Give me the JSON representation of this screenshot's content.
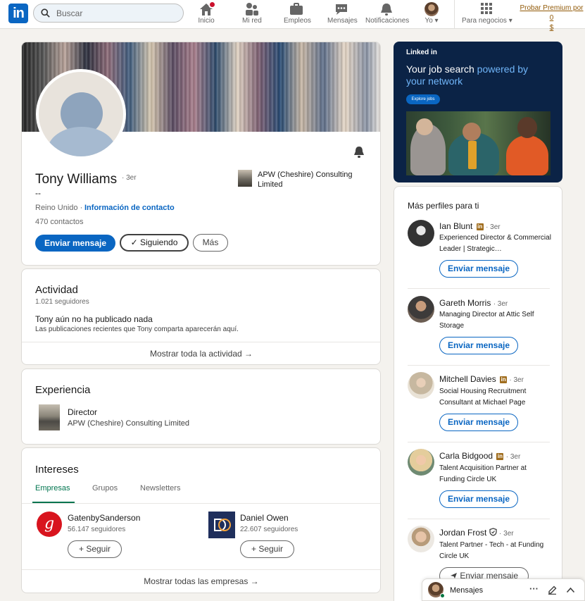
{
  "nav": {
    "search_placeholder": "Buscar",
    "items": [
      {
        "label": "Inicio",
        "icon": "home-icon"
      },
      {
        "label": "Mi red",
        "icon": "network-icon"
      },
      {
        "label": "Empleos",
        "icon": "briefcase-icon"
      },
      {
        "label": "Mensajes",
        "icon": "messaging-icon"
      },
      {
        "label": "Notificaciones",
        "icon": "bell-icon"
      },
      {
        "label": "Yo ▾",
        "icon": "avatar"
      },
      {
        "label": "Para negocios ▾",
        "icon": "grid-icon"
      }
    ],
    "premium_line1": "Probar Premium por 0",
    "premium_line2": "$",
    "accent": "#0a66c2"
  },
  "profile": {
    "name": "Tony Williams",
    "degree": "· 3er",
    "headline": "--",
    "location": "Reino Unido ·",
    "contact_link": "Información de contacto",
    "connections": "470 contactos",
    "company": "APW (Cheshire) Consulting Limited",
    "btn_message": "Enviar mensaje",
    "btn_following": "✓ Siguiendo",
    "btn_more": "Más"
  },
  "activity": {
    "title": "Actividad",
    "followers": "1.021 seguidores",
    "empty_title": "Tony aún no ha publicado nada",
    "empty_desc": "Las publicaciones recientes que Tony comparta aparecerán aquí.",
    "show_all": "Mostrar toda la actividad →"
  },
  "experience": {
    "title": "Experiencia",
    "role": "Director",
    "company": "APW (Cheshire) Consulting Limited"
  },
  "interests": {
    "title": "Intereses",
    "tabs": [
      "Empresas",
      "Grupos",
      "Newsletters"
    ],
    "companies": [
      {
        "name": "GatenbySanderson",
        "followers": "56.147 seguidores",
        "button": "+ Seguir"
      },
      {
        "name": "Daniel Owen",
        "followers": "22.607 seguidores",
        "button": "+ Seguir"
      }
    ],
    "show_all": "Mostrar todas las empresas →"
  },
  "ad": {
    "brand": "Linked in",
    "headline_a": "Your job search ",
    "headline_b": "powered by your network",
    "cta": "Explore jobs"
  },
  "more_profiles": {
    "title": "Más perfiles para ti",
    "people": [
      {
        "name": "Ian Blunt",
        "degree": "· 3er",
        "headline": "Experienced Director & Commercial Leader | Strategic…",
        "button": "Enviar mensaje"
      },
      {
        "name": "Gareth Morris",
        "degree": "· 3er",
        "headline": "Managing Director at Attic Self Storage",
        "button": "Enviar mensaje"
      },
      {
        "name": "Mitchell Davies",
        "degree": "· 3er",
        "headline": "Social Housing Recruitment Consultant at Michael Page",
        "button": "Enviar mensaje"
      },
      {
        "name": "Carla Bidgood",
        "degree": "· 3er",
        "headline": "Talent Acquisition Partner at Funding Circle UK",
        "button": "Enviar mensaje"
      },
      {
        "name": "Jordan Frost",
        "degree": "· 3er",
        "headline": "Talent Partner - Tech - at Funding Circle UK",
        "button": "Enviar mensaje"
      }
    ]
  },
  "messaging": {
    "label": "Mensajes"
  }
}
